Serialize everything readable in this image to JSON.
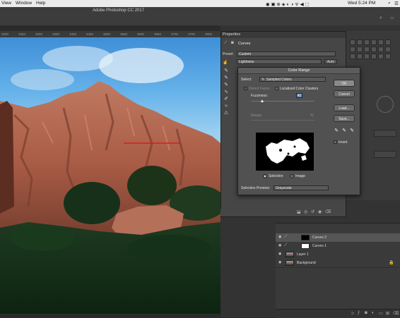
{
  "menubar": {
    "items": [
      "View",
      "Window",
      "Help"
    ],
    "clock": "Wed 5:24 PM"
  },
  "window": {
    "title": "Adobe Photoshop CC 2017"
  },
  "ruler": {
    "ticks": [
      "3200",
      "3250",
      "3300",
      "3350",
      "3400",
      "3450",
      "3500",
      "3550",
      "3600",
      "3650",
      "3700",
      "3750",
      "3800"
    ]
  },
  "properties": {
    "panel_title": "Properties",
    "layer_type": "Curves",
    "preset_label": "Preset:",
    "preset_value": "Custom",
    "channel_value": "Lightness",
    "auto_label": "Auto"
  },
  "color_range": {
    "title": "Color Range",
    "select_label": "Select:",
    "select_value": "Sampled Colors",
    "detect_faces": "Detect Faces",
    "localized": "Localized Color Clusters",
    "fuzziness_label": "Fuzziness:",
    "fuzziness_value": "40",
    "range_label": "Range:",
    "range_value": "%",
    "selection_option": "Selection",
    "image_option": "Image",
    "preview_label": "Selection Preview:",
    "preview_value": "Grayscale",
    "buttons": {
      "ok": "OK",
      "cancel": "Cancel",
      "load": "Load...",
      "save": "Save..."
    },
    "invert": "Invert"
  },
  "layers": {
    "rows": [
      {
        "name": "Curves 2",
        "selected": true
      },
      {
        "name": "Curves 1",
        "selected": false
      },
      {
        "name": "Layer 1",
        "selected": false
      },
      {
        "name": "Background",
        "selected": false
      }
    ]
  },
  "colors": {
    "dialog_bg": "#515151",
    "panel_bg": "#464646",
    "selected_row": "#555555",
    "rock": "#b0624d"
  }
}
